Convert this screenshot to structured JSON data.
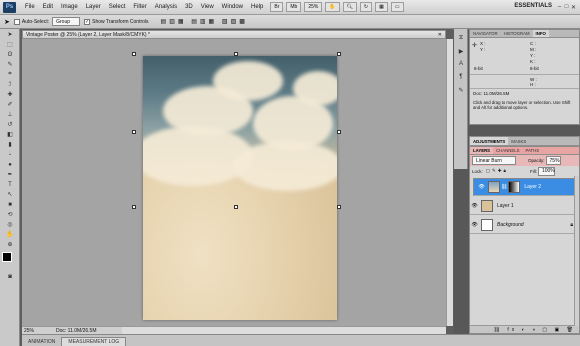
{
  "menubar": {
    "logo": "Ps",
    "items": [
      "File",
      "Edit",
      "Image",
      "Layer",
      "Select",
      "Filter",
      "Analysis",
      "3D",
      "View",
      "Window",
      "Help"
    ],
    "zoom": "25%",
    "workspace": "ESSENTIALS"
  },
  "options": {
    "auto_select_label": "Auto-Select:",
    "auto_select_value": "Group",
    "transform_label": "Show Transform Controls"
  },
  "document": {
    "tab_title": "Vintage Poster @ 25% (Layer 2, Layer Mask/8/CMYK) *",
    "zoom": "25%",
    "doc_size": "Doc: 11.0M/26.5M"
  },
  "bottom_tabs": [
    "ANIMATION",
    "MEASUREMENT LOG"
  ],
  "navigator": {
    "tabs": [
      "NAVIGATOR",
      "HISTOGRAM",
      "INFO"
    ],
    "info_labels": {
      "c": "C :",
      "m": "M :",
      "y": "Y :",
      "k": "K :",
      "x": "X :",
      "y2": "Y :",
      "w": "W :",
      "h": "H :"
    },
    "bit_left": "8-bit",
    "bit_right": "8-bit",
    "doc": "Doc: 11.0M/26.5M",
    "hint": "Click and drag to move layer or selection. Use Shift and Alt for additional options."
  },
  "adjustments": {
    "tabs": [
      "ADJUSTMENTS",
      "MASKS"
    ]
  },
  "layers": {
    "tabs": [
      "LAYERS",
      "CHANNELS",
      "PATHS"
    ],
    "blend_mode": "Linear Burn",
    "opacity_label": "Opacity:",
    "opacity_value": "75%",
    "lock_label": "Lock:",
    "fill_label": "Fill:",
    "fill_value": "100%",
    "rows": [
      {
        "name": "Layer 2",
        "selected": true
      },
      {
        "name": "Layer 1",
        "selected": false
      },
      {
        "name": "Background",
        "selected": false
      }
    ]
  },
  "colors": {
    "accent": "#3b8de3",
    "highlight": "#e8a3a3"
  }
}
